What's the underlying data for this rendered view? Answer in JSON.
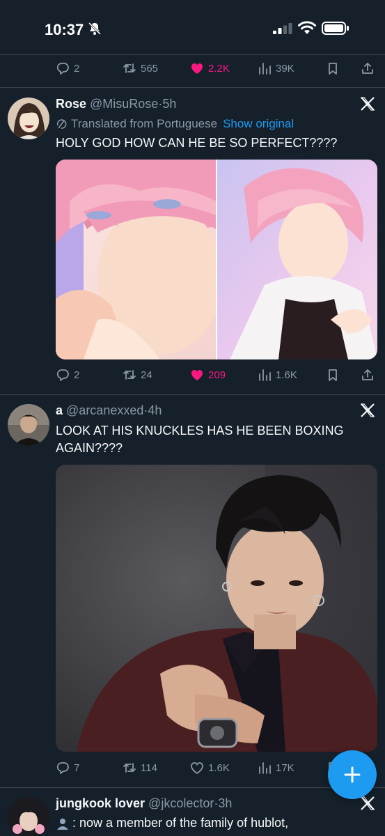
{
  "status_bar": {
    "time": "10:37"
  },
  "colors": {
    "background": "#15202b",
    "accent": "#1d9bf0",
    "like": "#f91880",
    "muted": "#8b98a5"
  },
  "top_actions": {
    "replies": "2",
    "retweets": "565",
    "likes": "2.2K",
    "views": "39K"
  },
  "tweets": [
    {
      "name": "Rose",
      "handle": "@MisuRose",
      "sep": "·",
      "time": "5h",
      "translated_label": "Translated from Portuguese",
      "show_original": "Show original",
      "text": "HOLY GOD HOW CAN HE BE SO PERFECT????",
      "replies": "2",
      "retweets": "24",
      "likes": "209",
      "views": "1.6K"
    },
    {
      "name": "a",
      "handle": "@arcanexxed",
      "sep": "·",
      "time": "4h",
      "text": "LOOK AT HIS KNUCKLES HAS HE BEEN BOXING AGAIN????",
      "replies": "7",
      "retweets": "114",
      "likes": "1.6K",
      "views": "17K"
    },
    {
      "name": "jungkook lover",
      "handle": "@jkcolector",
      "sep": "·",
      "time": "3h",
      "text": ": now a member of the family of hublot,"
    }
  ],
  "icons": [
    "bell-slash-icon",
    "signal-icon",
    "wifi-icon",
    "battery-icon",
    "reply-icon",
    "retweet-icon",
    "heart-icon",
    "views-icon",
    "bookmark-icon",
    "share-icon",
    "x-logo-icon",
    "translate-icon",
    "compose-plus-icon"
  ]
}
